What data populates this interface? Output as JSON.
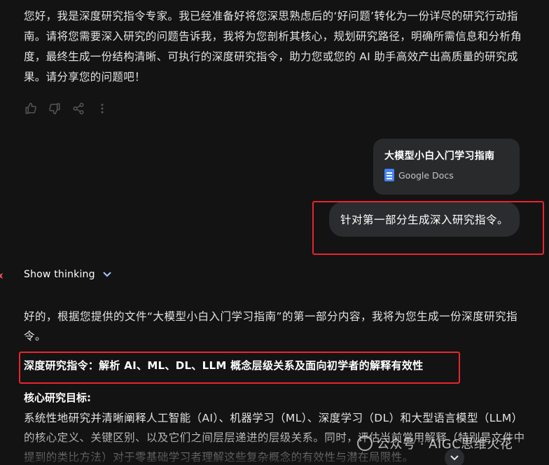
{
  "intro": {
    "text": "您好，我是深度研究指令专家。我已经准备好将您深思熟虑后的‘好问题’转化为一份详尽的研究行动指南。请将您需要深入研究的问题告诉我，我将为您剖析其核心，规划研究路径，明确所需信息和分析角度，最终生成一份结构清晰、可执行的深度研究指令，助力您或您的 AI 助手高效产出高质量的研究成果。请分享您的问题吧！"
  },
  "actions": {
    "icons": [
      "thumbs-up-icon",
      "thumbs-down-icon",
      "share-icon",
      "more-icon"
    ]
  },
  "attachment": {
    "title": "大模型小白入门学习指南",
    "source": "Google Docs",
    "icon": "google-docs-icon",
    "icon_color": "#4285f4"
  },
  "user_message": {
    "text": "针对第一部分生成深入研究指令。"
  },
  "thinking": {
    "label": "Show thinking",
    "icon": "chevron-down-icon"
  },
  "response": {
    "intro": "好的，根据您提供的文件“大模型小白入门学习指南”的第一部分内容，我将为您生成一份深度研究指令。",
    "title": "深度研究指令：解析 AI、ML、DL、LLM 概念层级关系及面向初学者的解释有效性",
    "goal_heading": "核心研究目标:",
    "goal_text": "系统性地研究并清晰阐释人工智能（AI）、机器学习（ML）、深度学习（DL）和大型语言模型（LLM）的核心定义、关键区别、以及它们之间层层递进的层级关系。同时，评估当前常用解释（特别是文件中提到的类比方法）对于零基础学习者理解这些复杂概念的有效性与潜在局限性。"
  },
  "watermark": {
    "text": "公众号 · AIGC思维火花"
  },
  "colors": {
    "background": "#131314",
    "highlight_box": "#e8252d",
    "user_bubble": "#2b2c2f"
  }
}
